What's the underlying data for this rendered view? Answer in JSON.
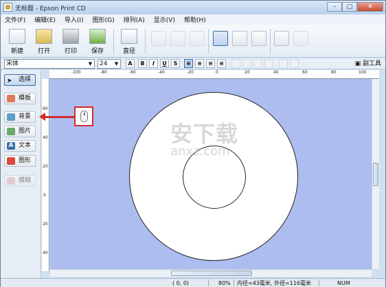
{
  "window": {
    "title": "无标题 - Epson Print CD"
  },
  "menubar": {
    "items": [
      "文件(F)",
      "编辑(E)",
      "导入(I)",
      "图形(G)",
      "排列(A)",
      "显示(V)",
      "帮助(H)"
    ]
  },
  "toolbar": {
    "new": "新建",
    "open": "打开",
    "print": "打印",
    "save": "保存",
    "diameter": "直径"
  },
  "format": {
    "font": "宋体",
    "size": "24",
    "secondary_tools": "副工具"
  },
  "ruler": {
    "h_labels": [
      "-100",
      "-80",
      "-60",
      "-40",
      "-20",
      "0",
      "20",
      "40",
      "60",
      "80",
      "100"
    ],
    "v_labels": [
      "60",
      "40",
      "20",
      "0",
      "20",
      "40",
      "60"
    ]
  },
  "left_tools": {
    "select": "选择",
    "template": "模板",
    "background": "背景",
    "image": "图片",
    "text": "文本",
    "shape": "图形",
    "blur": "模糊"
  },
  "status": {
    "coords": "( 0, 0)",
    "zoom": "80%",
    "diameters": "内径=43毫米, 外径=116毫米",
    "num": "NUM"
  },
  "watermark": {
    "main": "安下载",
    "sub": "anxz.com"
  },
  "colors": {
    "canvas_bg": "#adbdf0",
    "callout": "#d62a2a"
  }
}
